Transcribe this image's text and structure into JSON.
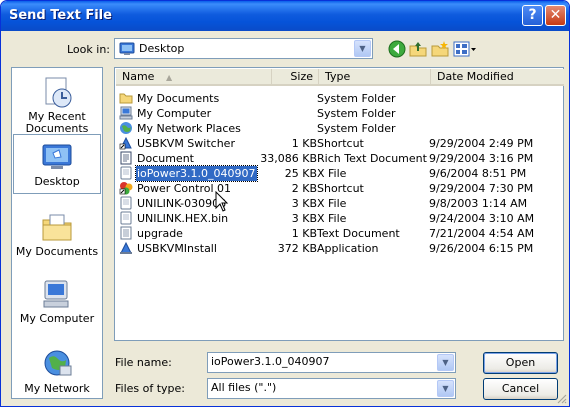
{
  "window": {
    "title": "Send Text File",
    "help_label": "?",
    "close_label": "✕"
  },
  "lookin": {
    "label": "Look in:",
    "value": "Desktop"
  },
  "toolbar": {
    "icons": [
      "back-icon",
      "up-folder-icon",
      "new-folder-icon",
      "views-menu-icon"
    ]
  },
  "places": [
    {
      "label": "My Recent Documents",
      "icon": "recent-documents-icon"
    },
    {
      "label": "Desktop",
      "icon": "desktop-icon",
      "selected": true
    },
    {
      "label": "My Documents",
      "icon": "my-documents-icon"
    },
    {
      "label": "My Computer",
      "icon": "my-computer-icon"
    },
    {
      "label": "My Network",
      "icon": "my-network-icon"
    }
  ],
  "columns": {
    "name": "Name",
    "size": "Size",
    "type": "Type",
    "date": "Date Modified"
  },
  "files": [
    {
      "name": "My Documents",
      "size": "",
      "type": "System Folder",
      "date": "",
      "icon": "folder-icon"
    },
    {
      "name": "My Computer",
      "size": "",
      "type": "System Folder",
      "date": "",
      "icon": "computer-icon"
    },
    {
      "name": "My Network Places",
      "size": "",
      "type": "System Folder",
      "date": "",
      "icon": "network-icon"
    },
    {
      "name": "USBKVM Switcher",
      "size": "1 KB",
      "type": "Shortcut",
      "date": "9/29/2004 2:49 PM",
      "icon": "app-shortcut-icon"
    },
    {
      "name": "Document",
      "size": "33,086 KB",
      "type": "Rich Text Document",
      "date": "9/29/2004 3:16 PM",
      "icon": "document-icon"
    },
    {
      "name": "ioPower3.1.0_040907",
      "size": "25 KB",
      "type": "X File",
      "date": "9/6/2004 8:51 PM",
      "icon": "file-icon",
      "selected": true
    },
    {
      "name": "Power Control 01",
      "size": "2 KB",
      "type": "Shortcut",
      "date": "9/29/2004 7:30 PM",
      "icon": "power-shortcut-icon"
    },
    {
      "name": "UNILINK-030908",
      "size": "3 KB",
      "type": "X File",
      "date": "9/8/2003 1:14 AM",
      "icon": "file-icon"
    },
    {
      "name": "UNILINK.HEX.bin",
      "size": "3 KB",
      "type": "X File",
      "date": "9/24/2004 3:10 AM",
      "icon": "file-icon"
    },
    {
      "name": "upgrade",
      "size": "1 KB",
      "type": "Text Document",
      "date": "7/21/2004 4:54 AM",
      "icon": "text-file-icon"
    },
    {
      "name": "USBKVMInstall",
      "size": "372 KB",
      "type": "Application",
      "date": "9/26/2004 6:15 PM",
      "icon": "installer-icon"
    }
  ],
  "filename": {
    "label": "File name:",
    "value": "ioPower3.1.0_040907"
  },
  "filetype": {
    "label": "Files of type:",
    "value": "All files (\".\")"
  },
  "buttons": {
    "open": "Open",
    "cancel": "Cancel"
  }
}
